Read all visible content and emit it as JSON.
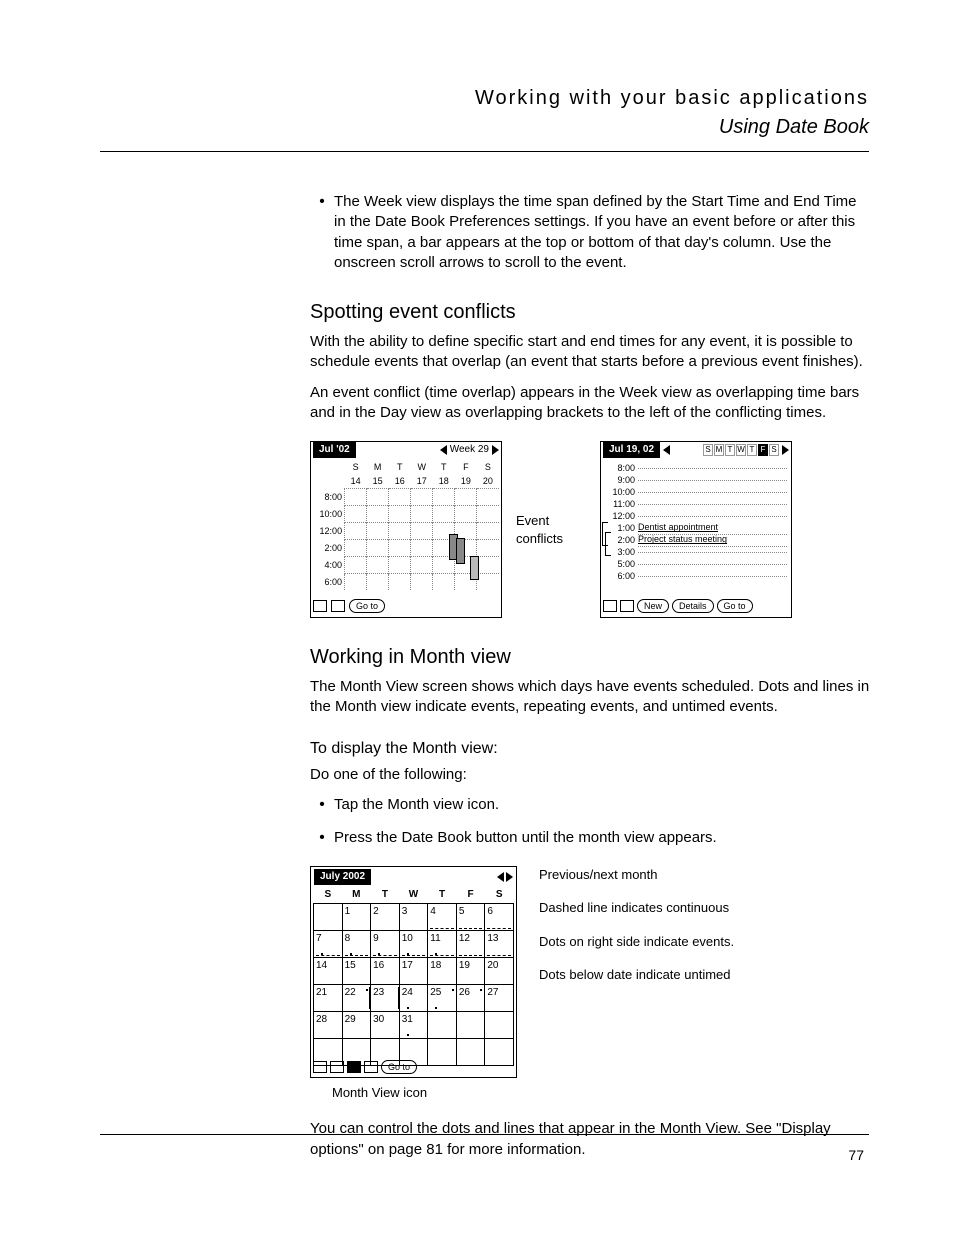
{
  "header": {
    "title": "Working with your basic applications",
    "subtitle": "Using Date Book"
  },
  "intro_bullet": "The Week view displays the time span defined by the Start Time and End Time in the Date Book Preferences settings. If you have an event before or after this time span, a bar appears at the top or bottom of that day's column. Use the onscreen scroll arrows to scroll to the event.",
  "sec1": {
    "h": "Spotting event conflicts",
    "p1": "With the ability to define specific start and end times for any event, it is possible to schedule events that overlap (an event that starts before a previous event finishes).",
    "p2": "An event conflict (time overlap) appears in the Week view as overlapping time bars and in the Day view as overlapping brackets to the left of the conflicting times."
  },
  "weekview": {
    "title": "Jul '02",
    "weeklabel": "Week 29",
    "day_initials": [
      "S",
      "M",
      "T",
      "W",
      "T",
      "F",
      "S"
    ],
    "day_nums": [
      "14",
      "15",
      "16",
      "17",
      "18",
      "19",
      "20"
    ],
    "hours": [
      "8:00",
      "10:00",
      "12:00",
      "2:00",
      "4:00",
      "6:00"
    ],
    "goto": "Go to"
  },
  "conflict_label": {
    "l1": "Event",
    "l2": "conflicts"
  },
  "dayview": {
    "title": "Jul 19, 02",
    "strip": [
      "S",
      "M",
      "T",
      "W",
      "T",
      "F",
      "S"
    ],
    "active_idx": 5,
    "rows": [
      {
        "t": "8:00",
        "txt": ""
      },
      {
        "t": "9:00",
        "txt": ""
      },
      {
        "t": "10:00",
        "txt": ""
      },
      {
        "t": "11:00",
        "txt": ""
      },
      {
        "t": "12:00",
        "txt": ""
      },
      {
        "t": "1:00",
        "txt": "Dentist appointment",
        "evt": true
      },
      {
        "t": "2:00",
        "txt": "Project status meeting",
        "evt": true
      },
      {
        "t": "3:00",
        "txt": ""
      },
      {
        "t": "5:00",
        "txt": ""
      },
      {
        "t": "6:00",
        "txt": ""
      }
    ],
    "btn_new": "New",
    "btn_details": "Details",
    "btn_goto": "Go to"
  },
  "sec2": {
    "h": "Working in Month view",
    "p1": "The Month View screen shows which days have events scheduled. Dots and lines in the Month view indicate events, repeating events, and untimed events.",
    "sub": "To display the Month view:",
    "lead": "Do one of the following:",
    "b1": "Tap the Month view icon.",
    "b2": "Press the Date Book button until the month view appears."
  },
  "monthview": {
    "title": "July 2002",
    "dh": [
      "S",
      "M",
      "T",
      "W",
      "T",
      "F",
      "S"
    ],
    "goto": "Go to",
    "cells": [
      [
        "",
        "1",
        "2",
        "3",
        "4",
        "5",
        "6"
      ],
      [
        "7",
        "8",
        "9",
        "10",
        "11",
        "12",
        "13"
      ],
      [
        "14",
        "15",
        "16",
        "17",
        "18",
        "19",
        "20"
      ],
      [
        "21",
        "22",
        "23",
        "24",
        "25",
        "26",
        "27"
      ],
      [
        "28",
        "29",
        "30",
        "31",
        "",
        "",
        ""
      ],
      [
        "",
        "",
        "",
        "",
        "",
        "",
        ""
      ]
    ]
  },
  "annots": {
    "a1": "Previous/next month",
    "a2": "Dashed line indicates continuous",
    "a3": "Dots on right side indicate events.",
    "a4": "Dots below date indicate untimed"
  },
  "month_caption": "Month View icon",
  "closing": "You can control the dots and lines that appear in the Month View. See \"Display options\" on page 81 for more information.",
  "page_number": "77"
}
